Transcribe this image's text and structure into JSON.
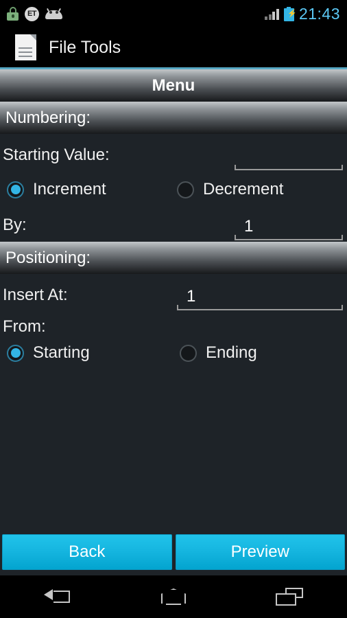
{
  "status_bar": {
    "icons": [
      "lock-icon",
      "et-icon",
      "android-droid-icon"
    ],
    "et_label": "ET",
    "signal_icon": "signal-bars-icon",
    "battery_icon": "battery-charging-icon",
    "time": "21:43",
    "time_color": "#5bc8f5"
  },
  "app_bar": {
    "icon": "document-icon",
    "title": "File Tools"
  },
  "menu_bar": {
    "title": "Menu"
  },
  "sections": {
    "numbering": {
      "header": "Numbering:",
      "starting_value": {
        "label": "Starting Value:",
        "value": "",
        "placeholder": ""
      },
      "direction": {
        "options": [
          {
            "label": "Increment",
            "selected": true
          },
          {
            "label": "Decrement",
            "selected": false
          }
        ]
      },
      "by": {
        "label": "By:",
        "value": "1"
      }
    },
    "positioning": {
      "header": "Positioning:",
      "insert_at": {
        "label": "Insert At:",
        "value": "1"
      },
      "from": {
        "label": "From:",
        "options": [
          {
            "label": "Starting",
            "selected": true
          },
          {
            "label": "Ending",
            "selected": false
          }
        ]
      }
    }
  },
  "buttons": {
    "back": "Back",
    "preview": "Preview",
    "accent_color": "#16b6e0"
  },
  "nav_bar": {
    "back": "back-icon",
    "home": "home-icon",
    "recents": "recent-apps-icon"
  }
}
